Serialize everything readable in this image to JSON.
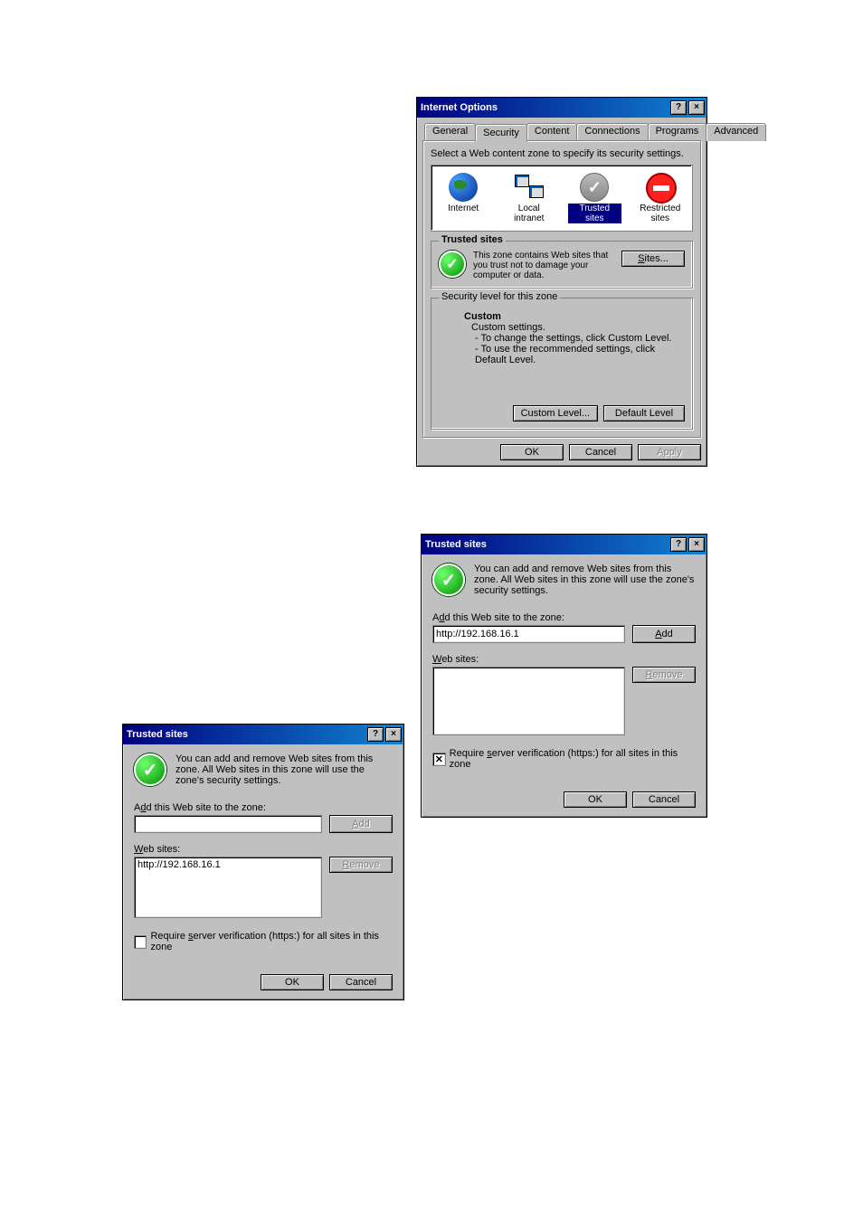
{
  "internet_options": {
    "title": "Internet Options",
    "tabs": [
      "General",
      "Security",
      "Content",
      "Connections",
      "Programs",
      "Advanced"
    ],
    "active_tab": 1,
    "instr": "Select a Web content zone to specify its security settings.",
    "zones": [
      {
        "label": "Internet"
      },
      {
        "label": "Local intranet"
      },
      {
        "label": "Trusted sites"
      },
      {
        "label": "Restricted sites"
      }
    ],
    "zone_panel": {
      "heading": "Trusted sites",
      "desc": "This zone contains Web sites that you trust not to damage your computer or data.",
      "sites_btn": "Sites..."
    },
    "level_panel": {
      "legend": "Security level for this zone",
      "heading": "Custom",
      "line1": "Custom settings.",
      "line2": "- To change the settings, click Custom Level.",
      "line3": "- To use the recommended settings, click Default Level.",
      "custom_btn": "Custom Level...",
      "default_btn": "Default Level"
    },
    "ok": "OK",
    "cancel": "Cancel",
    "apply": "Apply"
  },
  "trusted_a": {
    "title": "Trusted sites",
    "desc": "You can add and remove Web sites from this zone. All Web sites in this zone will use the zone's security settings.",
    "add_label_pre": "A",
    "add_label_u": "d",
    "add_label_post": "d this Web site to the zone:",
    "input_value": "http://192.168.16.1",
    "add_btn_pre": "",
    "add_btn_u": "A",
    "add_btn_post": "dd",
    "web_label_u": "W",
    "web_label_post": "eb sites:",
    "remove_btn_u": "R",
    "remove_btn_post": "emove",
    "require_pre": "Require ",
    "require_u": "s",
    "require_post": "erver verification (https:) for all sites in this zone",
    "require_checked": true,
    "ok": "OK",
    "cancel": "Cancel"
  },
  "trusted_b": {
    "title": "Trusted sites",
    "desc": "You can add and remove Web sites from this zone. All Web sites in this zone will use the zone's security settings.",
    "add_label_pre": "A",
    "add_label_u": "d",
    "add_label_post": "d this Web site to the zone:",
    "input_value": "",
    "add_btn_pre": "",
    "add_btn_u": "A",
    "add_btn_post": "dd",
    "web_label_u": "W",
    "web_label_post": "eb sites:",
    "list_item": "http://192.168.16.1",
    "remove_btn_u": "R",
    "remove_btn_post": "emove",
    "require_pre": "Require ",
    "require_u": "s",
    "require_post": "erver verification (https:) for all sites in this zone",
    "require_checked": false,
    "ok": "OK",
    "cancel": "Cancel"
  }
}
